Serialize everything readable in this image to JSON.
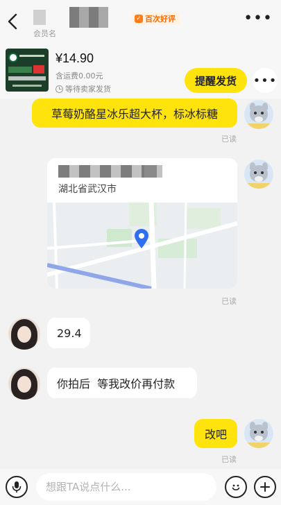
{
  "header": {
    "member_label": "会员名",
    "badge_text": "百次好评",
    "badge_icon": "good-review-icon"
  },
  "order": {
    "price": "¥14.90",
    "shipping": "含运费0.00元",
    "status": "等待卖家发货",
    "remind_button": "提醒发货"
  },
  "messages": [
    {
      "from": "me",
      "text": "草莓奶酪星冰乐超大杯，标冰标糖",
      "read": "已读"
    },
    {
      "from": "me",
      "type": "location",
      "address": "湖北省武汉市",
      "read": "已读"
    },
    {
      "from": "them",
      "text": "29.4"
    },
    {
      "from": "them",
      "text": "你拍后  等我改价再付款"
    },
    {
      "from": "me",
      "text": "改吧",
      "read": "已读"
    }
  ],
  "input": {
    "placeholder": "想跟TA说点什么..."
  },
  "colors": {
    "accent_yellow": "#ffe30c",
    "background": "#f2f2f2",
    "badge_orange": "#ff6a00"
  }
}
